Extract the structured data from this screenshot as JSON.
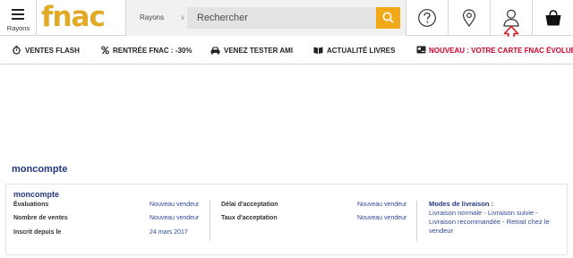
{
  "header": {
    "menu_label": "Rayons",
    "logo_text": "fnac",
    "rayons_select": "Rayons",
    "search_placeholder": "Rechercher",
    "icons": [
      "help-icon",
      "location-pin-icon",
      "user-icon",
      "basket-icon"
    ]
  },
  "nav": {
    "items": [
      {
        "label": "VENTES FLASH",
        "icon": "stopwatch-icon"
      },
      {
        "label": "RENTRÉE FNAC : -30%",
        "icon": "percent-icon"
      },
      {
        "label": "VENEZ TESTER AMI",
        "icon": "car-icon"
      },
      {
        "label": "ACTUALITÉ LIVRES",
        "icon": "open-book-icon"
      },
      {
        "label": "NOUVEAU : VOTRE CARTE FNAC ÉVOLUE",
        "icon": "card-icon"
      }
    ]
  },
  "account": {
    "title": "moncompte",
    "card_name": "moncompte",
    "left_rows": [
      {
        "label": "Évaluations",
        "value": "Nouveau vendeur"
      },
      {
        "label": "Nombre de ventes",
        "value": "Nouveau vendeur"
      },
      {
        "label": "Inscrit depuis le",
        "value": "24 mars 2017"
      }
    ],
    "mid_rows": [
      {
        "label": "Délai d'acceptation",
        "value": "Nouveau vendeur"
      },
      {
        "label": "Taux d'acceptation",
        "value": "Nouveau vendeur"
      }
    ],
    "modes_title": "Modes de livraison :",
    "modes_text": "Livraison normale - Livraison suivie - Livraison recommandée - Retrait chez le vendeur"
  },
  "colors": {
    "brand": "#e1a925",
    "search_button": "#f2a917",
    "link": "#2e4a9a",
    "heading": "#243881",
    "promo_red": "#d3002b",
    "annotation_arrow": "#e0141e"
  }
}
